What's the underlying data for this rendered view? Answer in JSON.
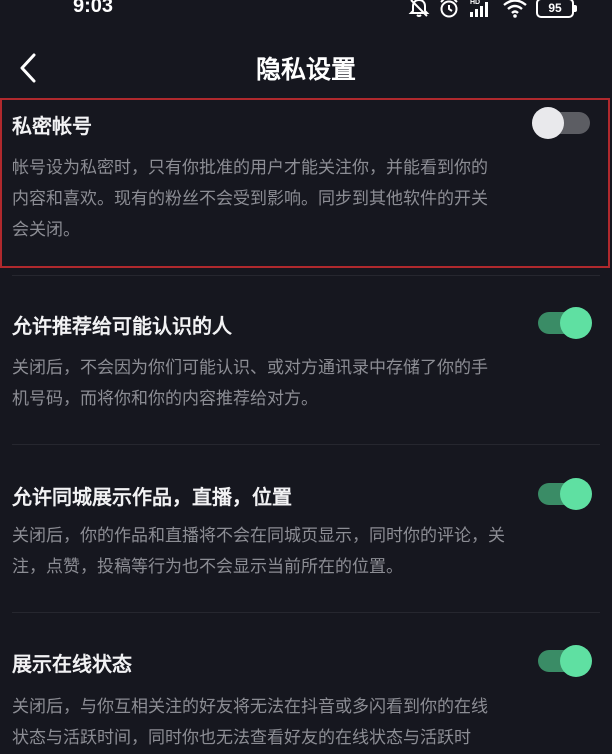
{
  "status_bar": {
    "time": "9:03",
    "battery_level": "95",
    "hd_label": "HD"
  },
  "header": {
    "title": "隐私设置"
  },
  "colors": {
    "background": "#16171f",
    "toggle_on_track": "#3a8c66",
    "toggle_on_knob": "#5fe0a2",
    "toggle_off_track": "#5c5d63",
    "highlight_border": "#b0292d"
  },
  "settings": [
    {
      "title": "私密帐号",
      "enabled": false,
      "description_lines": [
        "帐号设为私密时，只有你批准的用户才能关注你，并能看到你的",
        "内容和喜欢。现有的粉丝不会受到影响。同步到其他软件的开关",
        "会关闭。"
      ]
    },
    {
      "title": "允许推荐给可能认识的人",
      "enabled": true,
      "description_lines": [
        "关闭后，不会因为你们可能认识、或对方通讯录中存储了你的手",
        "机号码，而将你和你的内容推荐给对方。"
      ]
    },
    {
      "title": "允许同城展示作品，直播，位置",
      "enabled": true,
      "description_lines": [
        "关闭后，你的作品和直播将不会在同城页显示，同时你的评论，关",
        "注，点赞，投稿等行为也不会显示当前所在的位置。"
      ]
    },
    {
      "title": "展示在线状态",
      "enabled": true,
      "description_lines": [
        "关闭后，与你互相关注的好友将无法在抖音或多闪看到你的在线",
        "状态与活跃时间，同时你也无法查看好友的在线状态与活跃时"
      ]
    }
  ]
}
